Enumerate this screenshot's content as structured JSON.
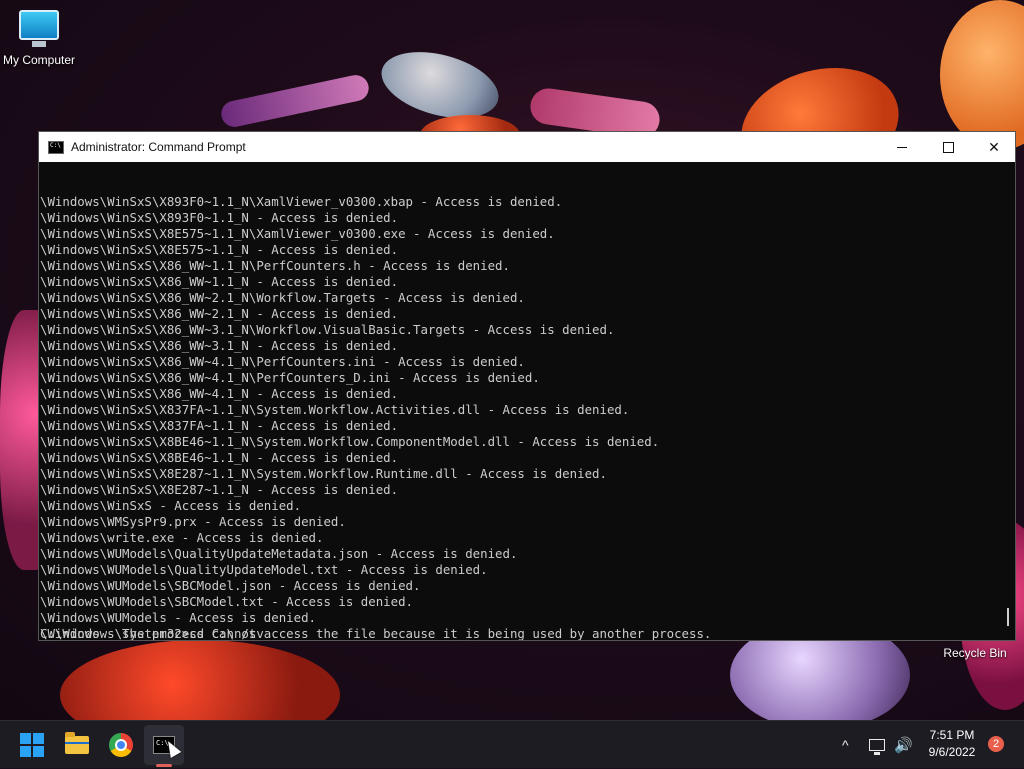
{
  "desktop": {
    "icons": [
      {
        "label": "My Computer"
      },
      {
        "label": "Recycle Bin"
      }
    ]
  },
  "window": {
    "title": "Administrator: Command Prompt",
    "controls": {
      "minimize": "—",
      "maximize": "☐",
      "close": "✕"
    }
  },
  "console": {
    "lines": [
      "\\Windows\\WinSxS\\X893F0~1.1_N\\XamlViewer_v0300.xbap - Access is denied.",
      "\\Windows\\WinSxS\\X893F0~1.1_N - Access is denied.",
      "\\Windows\\WinSxS\\X8E575~1.1_N\\XamlViewer_v0300.exe - Access is denied.",
      "\\Windows\\WinSxS\\X8E575~1.1_N - Access is denied.",
      "\\Windows\\WinSxS\\X86_WW~1.1_N\\PerfCounters.h - Access is denied.",
      "\\Windows\\WinSxS\\X86_WW~1.1_N - Access is denied.",
      "\\Windows\\WinSxS\\X86_WW~2.1_N\\Workflow.Targets - Access is denied.",
      "\\Windows\\WinSxS\\X86_WW~2.1_N - Access is denied.",
      "\\Windows\\WinSxS\\X86_WW~3.1_N\\Workflow.VisualBasic.Targets - Access is denied.",
      "\\Windows\\WinSxS\\X86_WW~3.1_N - Access is denied.",
      "\\Windows\\WinSxS\\X86_WW~4.1_N\\PerfCounters.ini - Access is denied.",
      "\\Windows\\WinSxS\\X86_WW~4.1_N\\PerfCounters_D.ini - Access is denied.",
      "\\Windows\\WinSxS\\X86_WW~4.1_N - Access is denied.",
      "\\Windows\\WinSxS\\X837FA~1.1_N\\System.Workflow.Activities.dll - Access is denied.",
      "\\Windows\\WinSxS\\X837FA~1.1_N - Access is denied.",
      "\\Windows\\WinSxS\\X8BE46~1.1_N\\System.Workflow.ComponentModel.dll - Access is denied.",
      "\\Windows\\WinSxS\\X8BE46~1.1_N - Access is denied.",
      "\\Windows\\WinSxS\\X8E287~1.1_N\\System.Workflow.Runtime.dll - Access is denied.",
      "\\Windows\\WinSxS\\X8E287~1.1_N - Access is denied.",
      "\\Windows\\WinSxS - Access is denied.",
      "\\Windows\\WMSysPr9.prx - Access is denied.",
      "\\Windows\\write.exe - Access is denied.",
      "\\Windows\\WUModels\\QualityUpdateMetadata.json - Access is denied.",
      "\\Windows\\WUModels\\QualityUpdateModel.txt - Access is denied.",
      "\\Windows\\WUModels\\SBCModel.json - Access is denied.",
      "\\Windows\\WUModels\\SBCModel.txt - Access is denied.",
      "\\Windows\\WUModels - Access is denied.",
      "\\Windows - The process cannot access the file because it is being used by another process."
    ],
    "prompt": "C:\\Windows\\system32>cd C:\\ /sv"
  },
  "taskbar": {
    "apps": [
      "start-icon",
      "file-explorer-icon",
      "chrome-icon",
      "command-prompt-icon"
    ],
    "tray": {
      "chevron": "^",
      "volume_icon": "🔊"
    },
    "clock": {
      "time": "7:51 PM",
      "date": "9/6/2022"
    },
    "notification_count": "2"
  }
}
